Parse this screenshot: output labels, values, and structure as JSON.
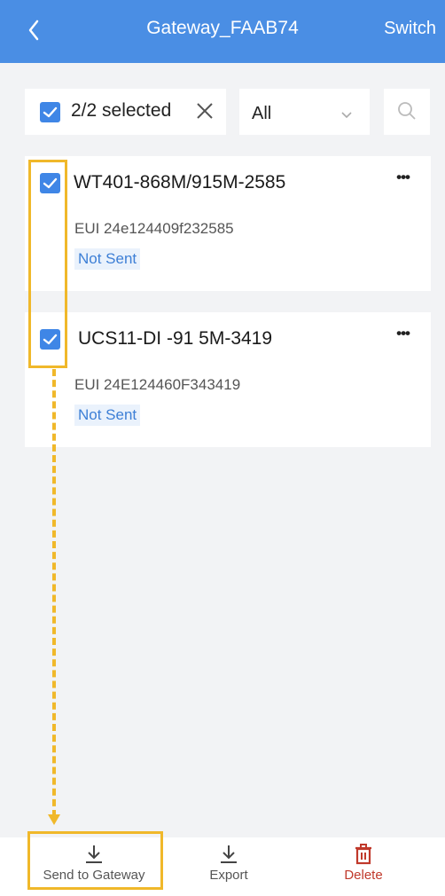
{
  "header": {
    "title": "Gateway_FAAB74",
    "switch_label": "Switch"
  },
  "filter": {
    "selected_text": "2/2 selected",
    "dropdown_value": "All"
  },
  "devices": [
    {
      "name": "WT401-868M/915M-2585",
      "eui": "EUI 24e124409f232585",
      "status": "Not Sent"
    },
    {
      "name": "UCS11-DI -91 5M-3419",
      "eui": "EUI 24E124460F343419",
      "status": "Not Sent"
    }
  ],
  "toolbar": {
    "send_label": "Send to Gateway",
    "export_label": "Export",
    "delete_label": "Delete"
  },
  "colors": {
    "header": "#4a8ee4",
    "checkbox": "#3f86e6",
    "highlight": "#f0b82a",
    "delete": "#c0392b",
    "status_text": "#3d7fd6"
  },
  "icons": {
    "back": "chevron-left-icon",
    "clear": "close-icon",
    "dropdown": "chevron-down-icon",
    "search": "search-icon",
    "more": "more-horizontal-icon",
    "send": "download-icon",
    "export": "download-icon",
    "delete": "trash-icon"
  }
}
